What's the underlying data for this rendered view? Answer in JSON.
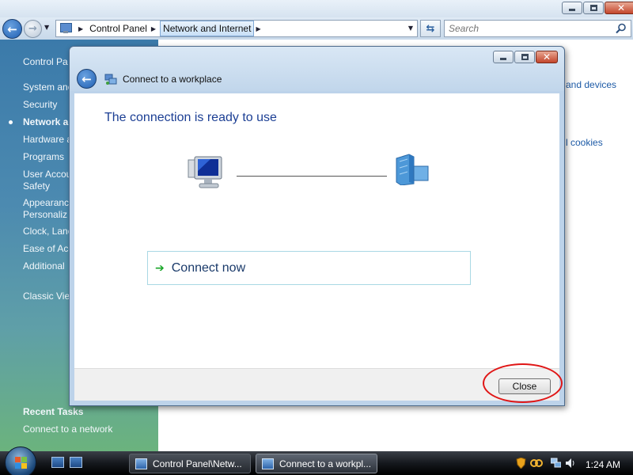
{
  "explorer": {
    "breadcrumbs": [
      "Control Panel",
      "Network and Internet"
    ],
    "search_placeholder": "Search",
    "sidebar": {
      "items": [
        "Control Pa",
        "System anc",
        "Security",
        "Network a",
        "Hardware a",
        "Programs",
        "User Accou",
        "Safety",
        "Appearanc",
        "Personaliz",
        "Clock, Lanc",
        "Ease of Acc",
        "Additional",
        "Classic View"
      ],
      "recent_tasks_heading": "Recent Tasks",
      "recent_task": "Connect to a network"
    },
    "content_links": [
      "and devices",
      "l cookies"
    ]
  },
  "dialog": {
    "title": "Connect to a workplace",
    "heading": "The connection is ready to use",
    "connect_now": "Connect now",
    "close_button": "Close"
  },
  "taskbar": {
    "buttons": [
      "Control Panel\\Netw...",
      "Connect to a workpl..."
    ],
    "clock": "1:24 AM"
  },
  "colors": {
    "heading": "#1c3f94",
    "highlight_ring": "#e01616",
    "sidebar": "#3b7aaa",
    "connect_arrow": "#19a628"
  },
  "icons": [
    "back-arrow-icon",
    "forward-arrow-icon",
    "control-panel-icon",
    "refresh-icon",
    "search-icon",
    "network-icon",
    "computer-icon",
    "server-icon",
    "green-arrow-icon",
    "windows-logo-icon",
    "shield-icon",
    "volume-icon"
  ]
}
